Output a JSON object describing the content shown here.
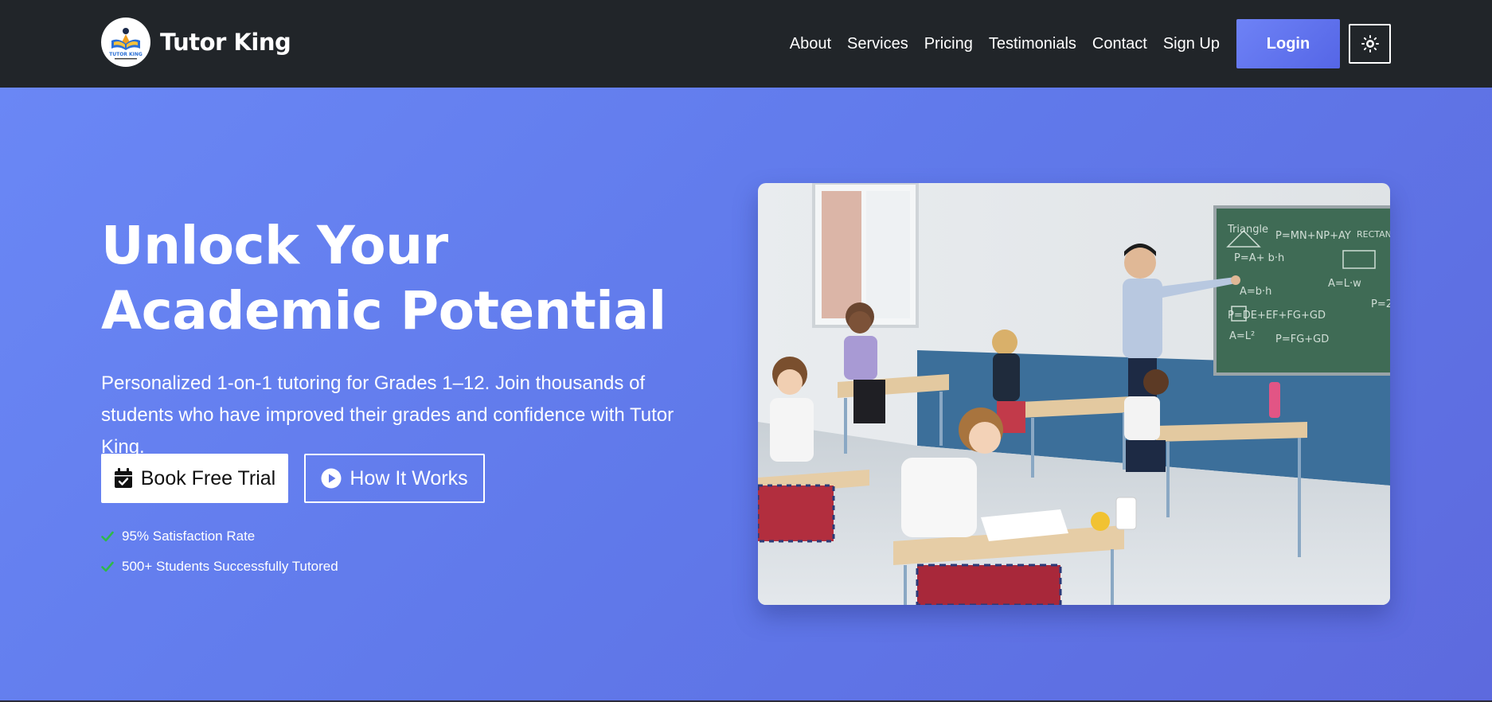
{
  "brand": {
    "name": "Tutor King",
    "logo_text": "TUTOR KING"
  },
  "nav": {
    "links": [
      {
        "label": "About"
      },
      {
        "label": "Services"
      },
      {
        "label": "Pricing"
      },
      {
        "label": "Testimonials"
      },
      {
        "label": "Contact"
      },
      {
        "label": "Sign Up"
      }
    ],
    "login_label": "Login",
    "theme_toggle_icon": "sun-icon"
  },
  "hero": {
    "headline": "Unlock Your Academic Potential",
    "subtext": "Personalized 1-on-1 tutoring for Grades 1–12. Join thousands of students who have improved their grades and confidence with Tutor King.",
    "primary_cta": {
      "label": "Book Free Trial",
      "icon": "calendar-check-icon"
    },
    "secondary_cta": {
      "label": "How It Works",
      "icon": "play-circle-icon"
    },
    "stats": [
      {
        "text": "95% Satisfaction Rate",
        "icon": "check-icon"
      },
      {
        "text": "500+ Students Successfully Tutored",
        "icon": "check-icon"
      }
    ],
    "image": {
      "subject": "classroom-photo"
    },
    "chalkboard_text": [
      "Triangle",
      "P=MN+NP+AY",
      "RECTAN",
      "P=A+ b·h",
      "A=b·h",
      "A=L·w",
      "P=2",
      "P=DE+EF+FG+GD",
      "A=L²",
      "P=FG+GD"
    ]
  },
  "colors": {
    "navbar_bg": "#212529",
    "hero_gradient_start": "#6a87f5",
    "hero_gradient_end": "#5d6ade",
    "accent": "#5d72ee",
    "check_green": "#2fb84a"
  }
}
